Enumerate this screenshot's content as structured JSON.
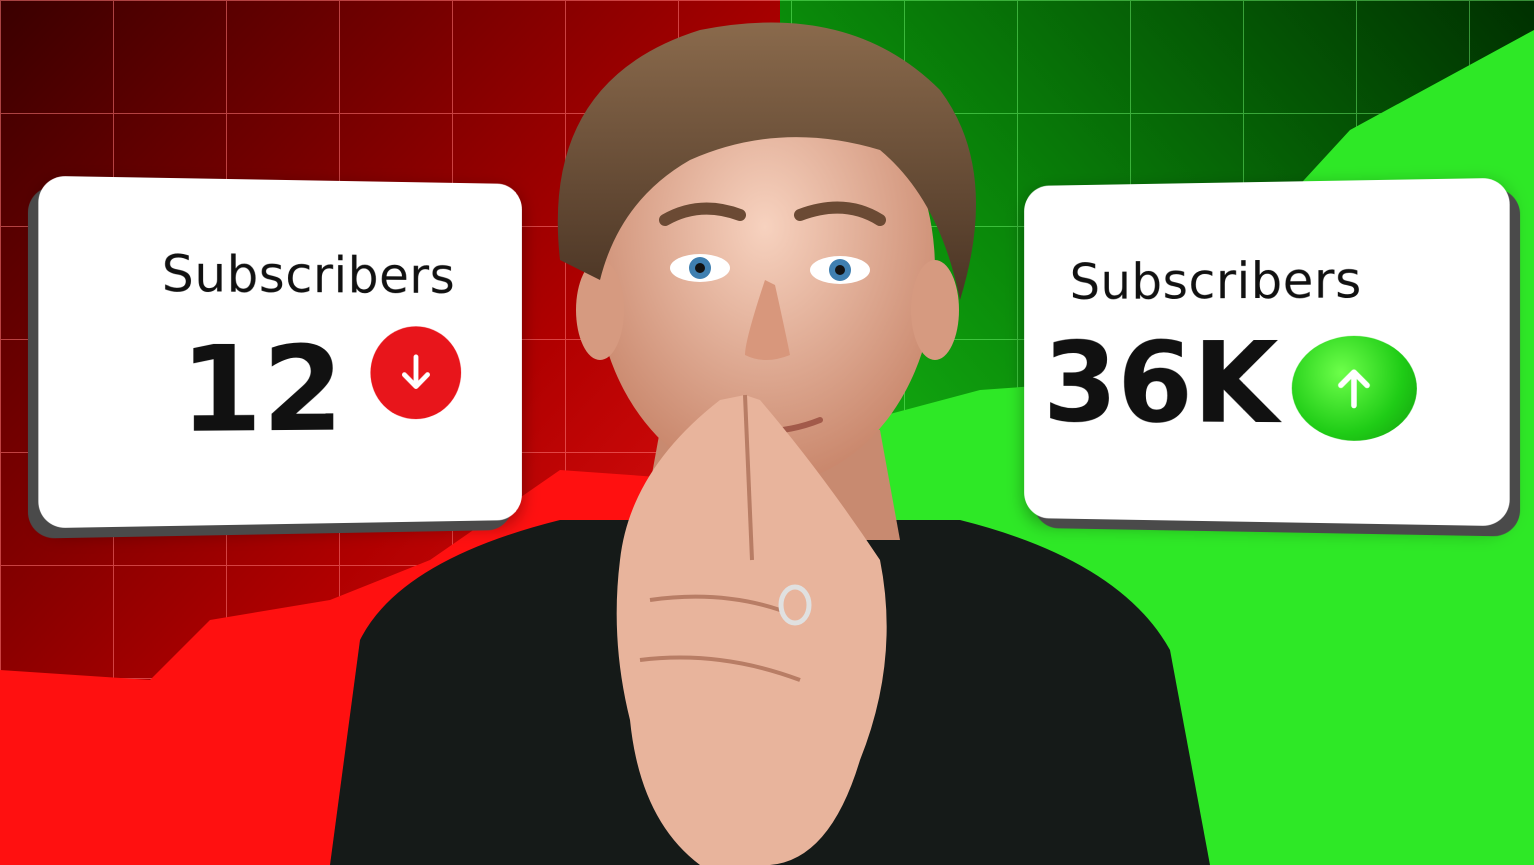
{
  "left_card": {
    "label": "Subscribers",
    "value": "12",
    "trend": "down",
    "trend_icon": "arrow-down-icon",
    "trend_color": "#e8151b"
  },
  "right_card": {
    "label": "Subscribers",
    "value": "36K",
    "trend": "up",
    "trend_icon": "arrow-up-icon",
    "trend_color": "#22cc1a"
  },
  "colors": {
    "left_background": "#c40000",
    "right_background": "#16c412"
  }
}
